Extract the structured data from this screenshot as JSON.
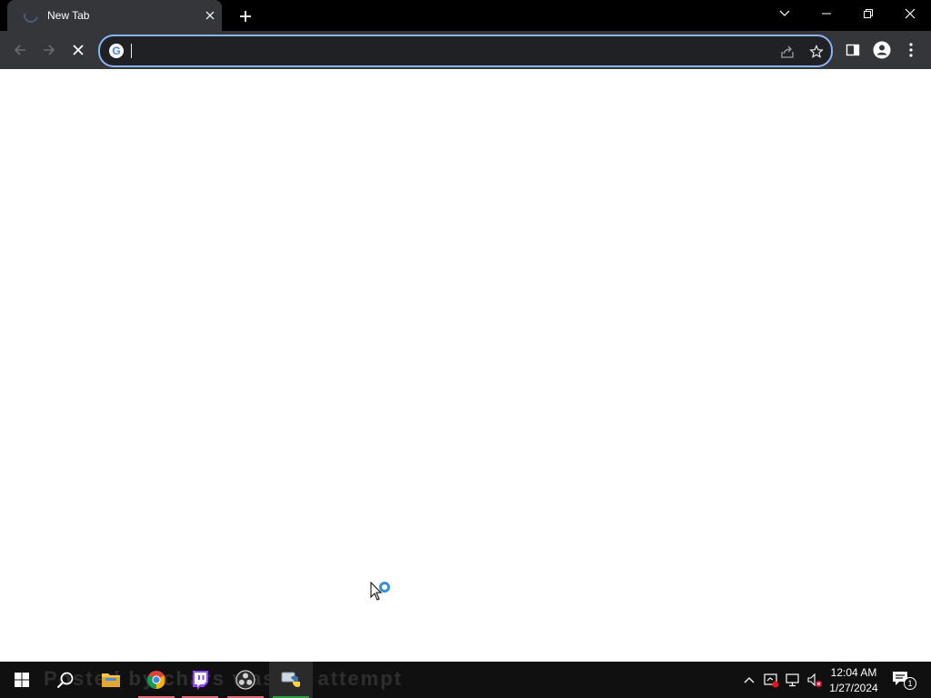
{
  "browser": {
    "tab": {
      "title": "New Tab"
    },
    "omnibox": {
      "value": "",
      "placeholder": ""
    }
  },
  "taskbar": {
    "apps": [
      {
        "name": "Google Chrome",
        "icon": "chrome-icon",
        "underline": "#e06c75"
      },
      {
        "name": "Twitch",
        "icon": "twitch-icon",
        "underline": "#e06c75"
      },
      {
        "name": "OBS Studio",
        "icon": "obs-icon",
        "underline": "#e06c75"
      },
      {
        "name": "Python",
        "icon": "python-icon",
        "underline": "#2ea043"
      }
    ],
    "watermark": "Posted by chars was an attempt",
    "clock": {
      "time": "12:04 AM",
      "date": "1/27/2024"
    },
    "notification_count": "1"
  },
  "colors": {
    "titlebar": "#000000",
    "toolbar": "#35363a",
    "omnibox_border": "#8ab4f8",
    "taskbar": "#101010"
  }
}
